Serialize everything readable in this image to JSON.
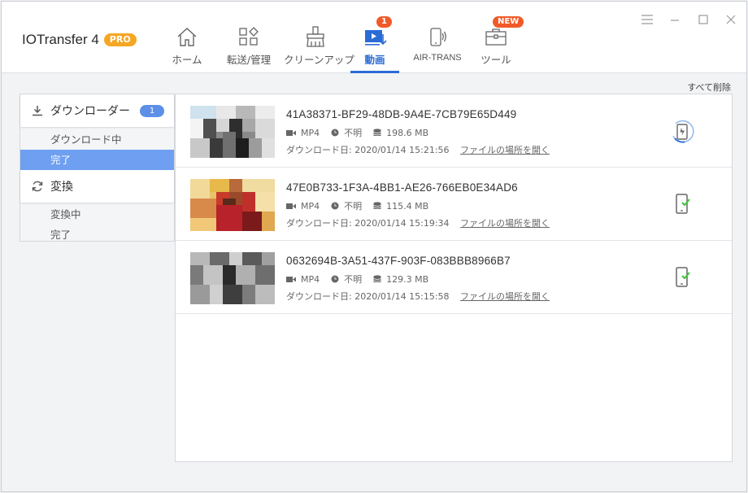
{
  "app": {
    "name": "IOTransfer 4",
    "badge": "PRO"
  },
  "nav": [
    {
      "label": "ホーム",
      "icon": "home-icon"
    },
    {
      "label": "転送/管理",
      "icon": "grid-icon"
    },
    {
      "label": "クリーンアップ",
      "icon": "broom-icon"
    },
    {
      "label": "動画",
      "icon": "video-download-icon",
      "badge": "1",
      "active": true
    },
    {
      "label": "AIR-TRANS",
      "icon": "wireless-phone-icon"
    },
    {
      "label": "ツール",
      "icon": "toolbox-icon",
      "badge": "NEW"
    }
  ],
  "colors": {
    "accent": "#2b6bd6",
    "badge_orange": "#f05a28",
    "pro": "#f5a623",
    "selected": "#6e9ff0",
    "check": "#3cc43c"
  },
  "actions": {
    "clear_all": "すべて削除"
  },
  "sidebar": {
    "downloader": {
      "label": "ダウンローダー",
      "count": "1",
      "items": [
        "ダウンロード中",
        "完了"
      ],
      "selected": "完了"
    },
    "convert": {
      "label": "変換",
      "items": [
        "変換中",
        "完了"
      ]
    }
  },
  "videos": [
    {
      "title": "41A38371-BF29-48DB-9A4E-7CB79E65D449",
      "format": "MP4",
      "duration": "不明",
      "size": "198.6 MB",
      "date_label": "ダウンロード日:",
      "date": "2020/01/14 15:21:56",
      "open": "ファイルの場所を開く",
      "status": "transferring"
    },
    {
      "title": "47E0B733-1F3A-4BB1-AE26-766EB0E34AD6",
      "format": "MP4",
      "duration": "不明",
      "size": "115.4 MB",
      "date_label": "ダウンロード日:",
      "date": "2020/01/14 15:19:34",
      "open": "ファイルの場所を開く",
      "status": "done"
    },
    {
      "title": "0632694B-3A51-437F-903F-083BBB8966B7",
      "format": "MP4",
      "duration": "不明",
      "size": "129.3 MB",
      "date_label": "ダウンロード日:",
      "date": "2020/01/14 15:15:58",
      "open": "ファイルの場所を開く",
      "status": "done"
    }
  ]
}
